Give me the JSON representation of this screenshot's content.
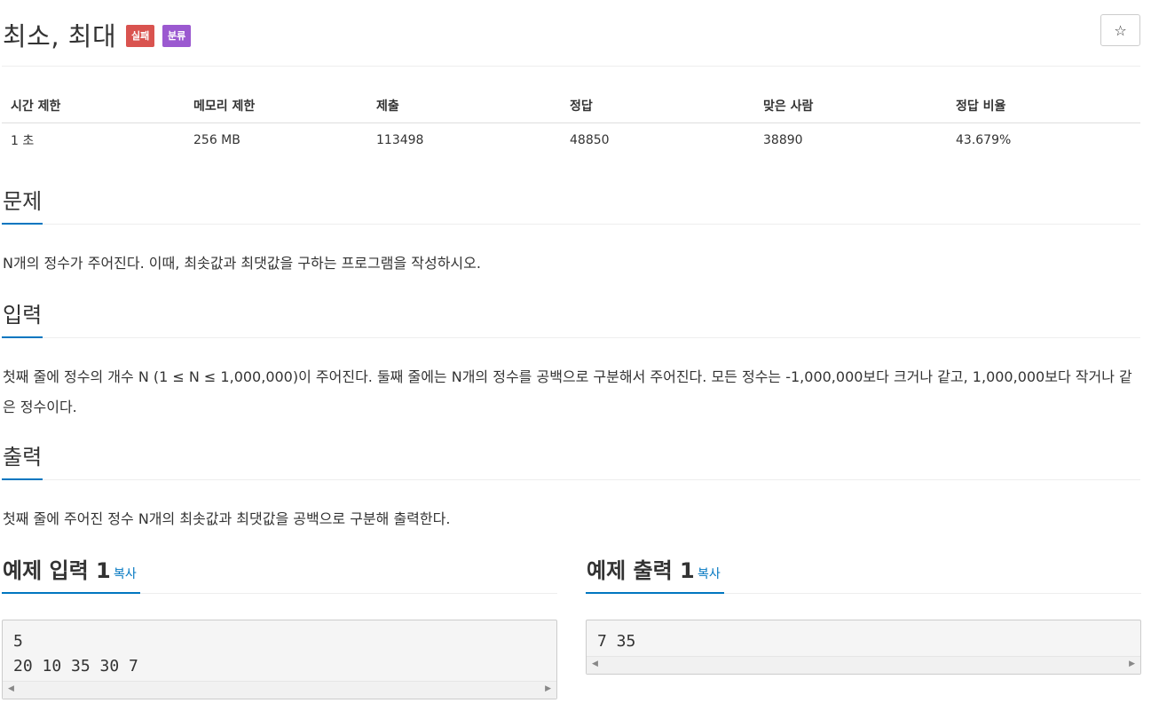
{
  "problem": {
    "title": "최소, 최대",
    "badges": {
      "fail": "실패",
      "tag": "분류"
    },
    "star_icon": "☆"
  },
  "info_table": {
    "headers": [
      "시간 제한",
      "메모리 제한",
      "제출",
      "정답",
      "맞은 사람",
      "정답 비율"
    ],
    "values": [
      "1 초",
      "256 MB",
      "113498",
      "48850",
      "38890",
      "43.679%"
    ]
  },
  "sections": {
    "description": {
      "title": "문제",
      "text": "N개의 정수가 주어진다. 이때, 최솟값과 최댓값을 구하는 프로그램을 작성하시오."
    },
    "input": {
      "title": "입력",
      "text": "첫째 줄에 정수의 개수 N (1 ≤ N ≤ 1,000,000)이 주어진다. 둘째 줄에는 N개의 정수를 공백으로 구분해서 주어진다. 모든 정수는 -1,000,000보다 크거나 같고, 1,000,000보다 작거나 같은 정수이다."
    },
    "output": {
      "title": "출력",
      "text": "첫째 줄에 주어진 정수 N개의 최솟값과 최댓값을 공백으로 구분해 출력한다."
    }
  },
  "samples": {
    "input": {
      "title": "예제 입력 1",
      "copy_label": "복사",
      "content": "5\n20 10 35 30 7"
    },
    "output": {
      "title": "예제 출력 1",
      "copy_label": "복사",
      "content": "7 35"
    }
  },
  "icons": {
    "scroll_left": "◀",
    "scroll_right": "▶"
  },
  "colors": {
    "accent": "#0076c0",
    "badge_fail": "#d9534f",
    "badge_tag": "#9b59d0"
  }
}
